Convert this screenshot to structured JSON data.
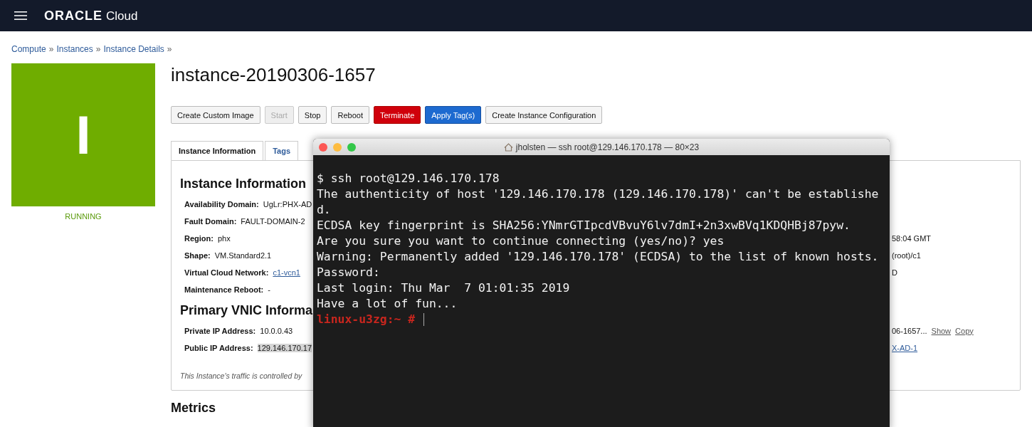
{
  "header": {
    "brand": "ORACLE",
    "product": "Cloud"
  },
  "breadcrumbs": [
    "Compute",
    "Instances",
    "Instance Details"
  ],
  "breadcrumb_separator": "»",
  "instance": {
    "letter": "I",
    "status": "RUNNING",
    "title": "instance-20190306-1657"
  },
  "actions": [
    {
      "label": "Create Custom Image",
      "kind": "default",
      "disabled": false
    },
    {
      "label": "Start",
      "kind": "default",
      "disabled": true
    },
    {
      "label": "Stop",
      "kind": "default",
      "disabled": false
    },
    {
      "label": "Reboot",
      "kind": "default",
      "disabled": false
    },
    {
      "label": "Terminate",
      "kind": "danger",
      "disabled": false
    },
    {
      "label": "Apply Tag(s)",
      "kind": "primary",
      "disabled": false
    },
    {
      "label": "Create Instance Configuration",
      "kind": "default",
      "disabled": false
    }
  ],
  "tabs": [
    {
      "label": "Instance Information",
      "selected": true
    },
    {
      "label": "Tags",
      "selected": false
    }
  ],
  "sections": [
    {
      "heading": "Instance Information",
      "left": [
        {
          "label": "Availability Domain:",
          "value": "UgLr:PHX-AD",
          "kind": "text"
        },
        {
          "label": "Fault Domain:",
          "value": "FAULT-DOMAIN-2",
          "kind": "text"
        },
        {
          "label": "Region:",
          "value": "phx",
          "kind": "text"
        },
        {
          "label": "Shape:",
          "value": "VM.Standard2.1",
          "kind": "text"
        },
        {
          "label": "Virtual Cloud Network:",
          "value": "c1-vcn1",
          "kind": "link"
        },
        {
          "label": "Maintenance Reboot:",
          "value": "-",
          "kind": "text"
        }
      ],
      "right": [
        {
          "value": "58:04 GMT",
          "kind": "text"
        },
        {
          "value": "(root)/c1",
          "kind": "text"
        },
        {
          "value": "D",
          "kind": "text"
        }
      ]
    },
    {
      "heading": "Primary VNIC Informa",
      "left": [
        {
          "label": "Private IP Address:",
          "value": "10.0.0.43",
          "kind": "text"
        },
        {
          "label": "Public IP Address:",
          "value": "129.146.170.17",
          "kind": "highlight"
        }
      ],
      "right": [
        {
          "value": "06-1657...",
          "kind": "text",
          "links": [
            "Show",
            "Copy"
          ]
        },
        {
          "value": "X-AD-1",
          "kind": "link"
        }
      ]
    }
  ],
  "note": "This Instance's traffic is controlled by",
  "next_heading": "Metrics",
  "terminal": {
    "title": "jholsten — ssh root@129.146.170.178 — 80×23",
    "lines": [
      {
        "text": "$ ssh root@129.146.170.178",
        "kind": "output"
      },
      {
        "text": "The authenticity of host '129.146.170.178 (129.146.170.178)' can't be establishe",
        "kind": "output"
      },
      {
        "text": "d.",
        "kind": "output"
      },
      {
        "text": "ECDSA key fingerprint is SHA256:YNmrGTIpcdVBvuY6lv7dmI+2n3xwBVq1KDQHBj87pyw.",
        "kind": "output"
      },
      {
        "text": "Are you sure you want to continue connecting (yes/no)? yes",
        "kind": "output"
      },
      {
        "text": "Warning: Permanently added '129.146.170.178' (ECDSA) to the list of known hosts.",
        "kind": "output"
      },
      {
        "text": "Password:",
        "kind": "output"
      },
      {
        "text": "Last login: Thu Mar  7 01:01:35 2019",
        "kind": "output"
      },
      {
        "text": "Have a lot of fun...",
        "kind": "output"
      },
      {
        "text": "linux-u3zg:~ #",
        "kind": "prompt"
      }
    ]
  }
}
